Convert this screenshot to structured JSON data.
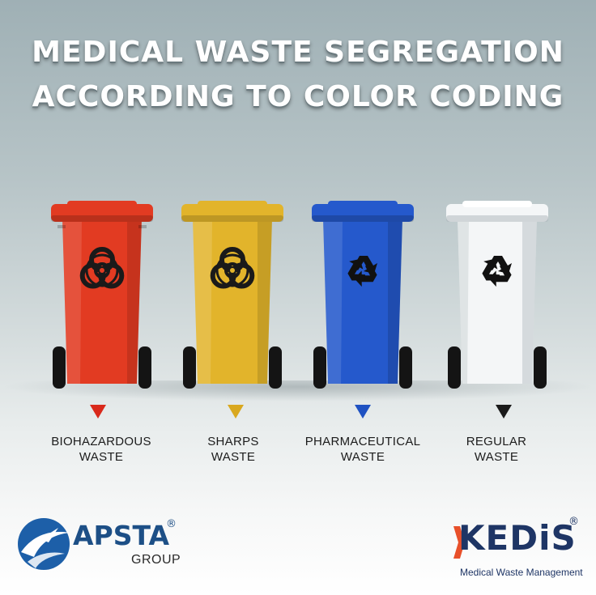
{
  "title": {
    "line1": "MEDICAL WASTE SEGREGATION",
    "line2": "ACCORDING TO COLOR CODING"
  },
  "bins": [
    {
      "name": "biohazardous",
      "color": "#e23b22",
      "symbol": "biohazard-icon",
      "label_line1": "BIOHAZARDOUS",
      "label_line2": "WASTE",
      "marker_color": "#d9291b"
    },
    {
      "name": "sharps",
      "color": "#e2b42b",
      "symbol": "biohazard-icon",
      "label_line1": "SHARPS",
      "label_line2": "WASTE",
      "marker_color": "#d9a81f"
    },
    {
      "name": "pharmaceutical",
      "color": "#2559cc",
      "symbol": "recycle-icon",
      "label_line1": "PHARMACEUTICAL",
      "label_line2": "WASTE",
      "marker_color": "#1f52c2"
    },
    {
      "name": "regular",
      "color": "#f4f6f7",
      "symbol": "recycle-icon",
      "label_line1": "REGULAR",
      "label_line2": "WASTE",
      "marker_color": "#1a1a1a"
    }
  ],
  "logos": {
    "apsta": {
      "name": "APSTA",
      "sub": "GROUP",
      "reg": "®"
    },
    "kedis": {
      "name": "KEDiS",
      "sub": "Medical Waste Management",
      "reg": "®"
    }
  }
}
